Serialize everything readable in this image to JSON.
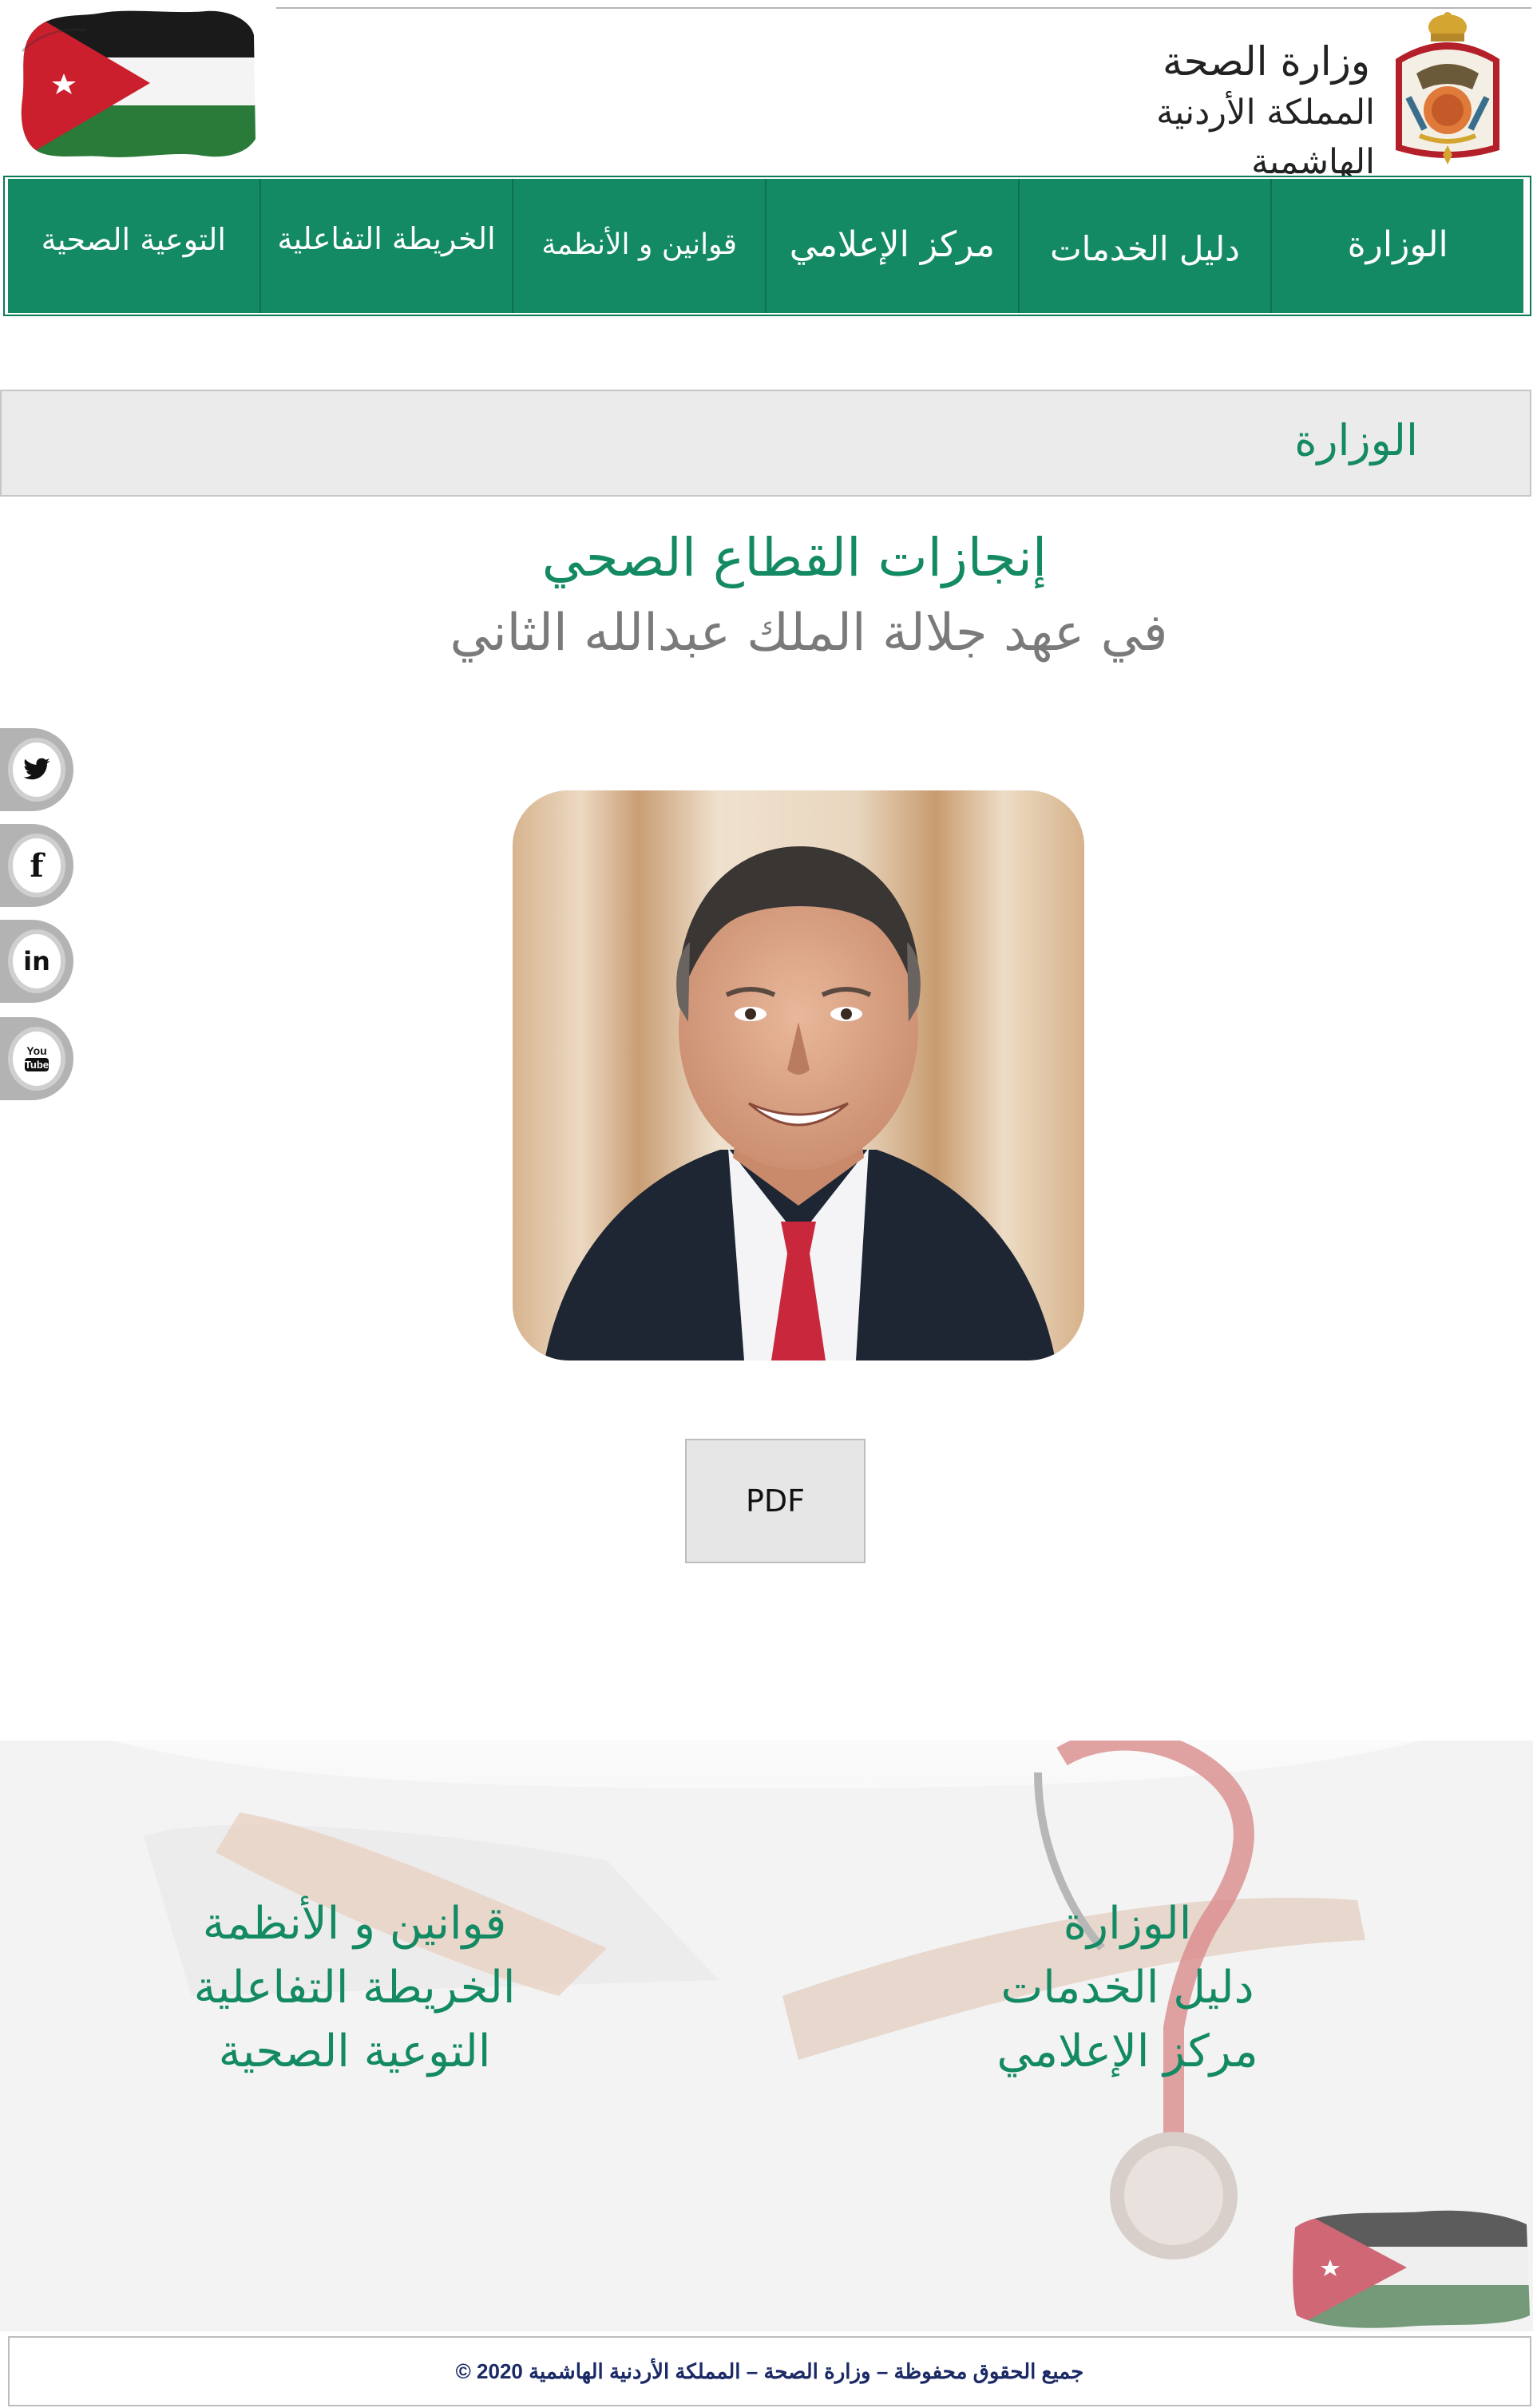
{
  "header": {
    "ministry_line1": "وزارة الصحة",
    "ministry_line2": "المملكة الأردنية الهاشمية",
    "brand_green": "#138a63"
  },
  "nav": {
    "items": [
      {
        "label": "الوزارة"
      },
      {
        "label": "دليل الخدمات"
      },
      {
        "label": "مركز الإعلامي"
      },
      {
        "label": "قوانين و الأنظمة"
      },
      {
        "label": "الخريطة التفاعلية"
      },
      {
        "label": "التوعية الصحية"
      }
    ]
  },
  "breadcrumb": {
    "current": "الوزارة"
  },
  "main": {
    "title": "إنجازات القطاع الصحي",
    "subtitle": "في عهد جلالة الملك عبدالله الثاني",
    "pdf_label": "PDF"
  },
  "social": {
    "items": [
      {
        "icon": "twitter-icon",
        "glyph": "t"
      },
      {
        "icon": "facebook-icon",
        "glyph": "f"
      },
      {
        "icon": "linkedin-icon",
        "glyph": "in"
      },
      {
        "icon": "youtube-icon",
        "glyph": "You\nTube"
      }
    ]
  },
  "footer": {
    "right_links": [
      {
        "label": "الوزارة"
      },
      {
        "label": "دليل الخدمات"
      },
      {
        "label": "مركز الإعلامي"
      }
    ],
    "left_links": [
      {
        "label": "قوانين و الأنظمة"
      },
      {
        "label": "الخريطة التفاعلية"
      },
      {
        "label": "التوعية الصحية"
      }
    ],
    "copyright": "جميع الحقوق محفوظة – وزارة الصحة – المملكة الأردنية الهاشمية 2020 ©"
  }
}
